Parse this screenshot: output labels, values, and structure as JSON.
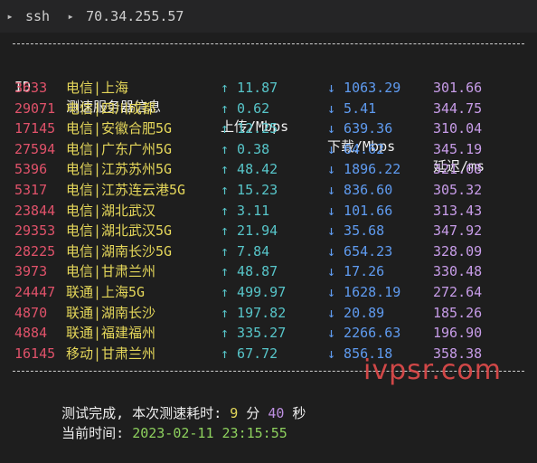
{
  "titlebar": {
    "path": [
      "ssh",
      "70.34.255.57"
    ]
  },
  "table": {
    "headers": {
      "id": "ID",
      "server": "测速服务器信息",
      "up": "上传/Mbps",
      "down": "下载/Mbps",
      "latency": "延迟/ms"
    },
    "rows": [
      {
        "id": "3633",
        "server": "电信|上海",
        "up": "↑ 11.87",
        "down": "↓ 1063.29",
        "latency": "301.66"
      },
      {
        "id": "29071",
        "server": "电信|四川成都",
        "up": "↑ 0.62",
        "down": "↓ 5.41",
        "latency": "344.75"
      },
      {
        "id": "17145",
        "server": "电信|安徽合肥5G",
        "up": "↑ 12.25",
        "down": "↓ 639.36",
        "latency": "310.04"
      },
      {
        "id": "27594",
        "server": "电信|广东广州5G",
        "up": "↑ 0.38",
        "down": "↓ 64.62",
        "latency": "345.19"
      },
      {
        "id": "5396",
        "server": "电信|江苏苏州5G",
        "up": "↑ 48.42",
        "down": "↓ 1896.22",
        "latency": "321.68"
      },
      {
        "id": "5317",
        "server": "电信|江苏连云港5G",
        "up": "↑ 15.23",
        "down": "↓ 836.60",
        "latency": "305.32"
      },
      {
        "id": "23844",
        "server": "电信|湖北武汉",
        "up": "↑ 3.11",
        "down": "↓ 101.66",
        "latency": "313.43"
      },
      {
        "id": "29353",
        "server": "电信|湖北武汉5G",
        "up": "↑ 21.94",
        "down": "↓ 35.68",
        "latency": "347.92"
      },
      {
        "id": "28225",
        "server": "电信|湖南长沙5G",
        "up": "↑ 7.84",
        "down": "↓ 654.23",
        "latency": "328.09"
      },
      {
        "id": "3973",
        "server": "电信|甘肃兰州",
        "up": "↑ 48.87",
        "down": "↓ 17.26",
        "latency": "330.48"
      },
      {
        "id": "24447",
        "server": "联通|上海5G",
        "up": "↑ 499.97",
        "down": "↓ 1628.19",
        "latency": "272.64"
      },
      {
        "id": "4870",
        "server": "联通|湖南长沙",
        "up": "↑ 197.82",
        "down": "↓ 20.89",
        "latency": "185.26"
      },
      {
        "id": "4884",
        "server": "联通|福建福州",
        "up": "↑ 335.27",
        "down": "↓ 2266.63",
        "latency": "196.90"
      },
      {
        "id": "16145",
        "server": "移动|甘肃兰州",
        "up": "↑ 67.72",
        "down": "↓ 856.18",
        "latency": "358.38"
      }
    ]
  },
  "summary": {
    "done_label": "测试完成, 本次测速耗时: ",
    "minutes": "9",
    "min_unit": " 分 ",
    "seconds": "40",
    "sec_unit": " 秒",
    "time_label": "当前时间: ",
    "time_value": "2023-02-11 23:15:55"
  },
  "watermark": "ivpsr.com"
}
